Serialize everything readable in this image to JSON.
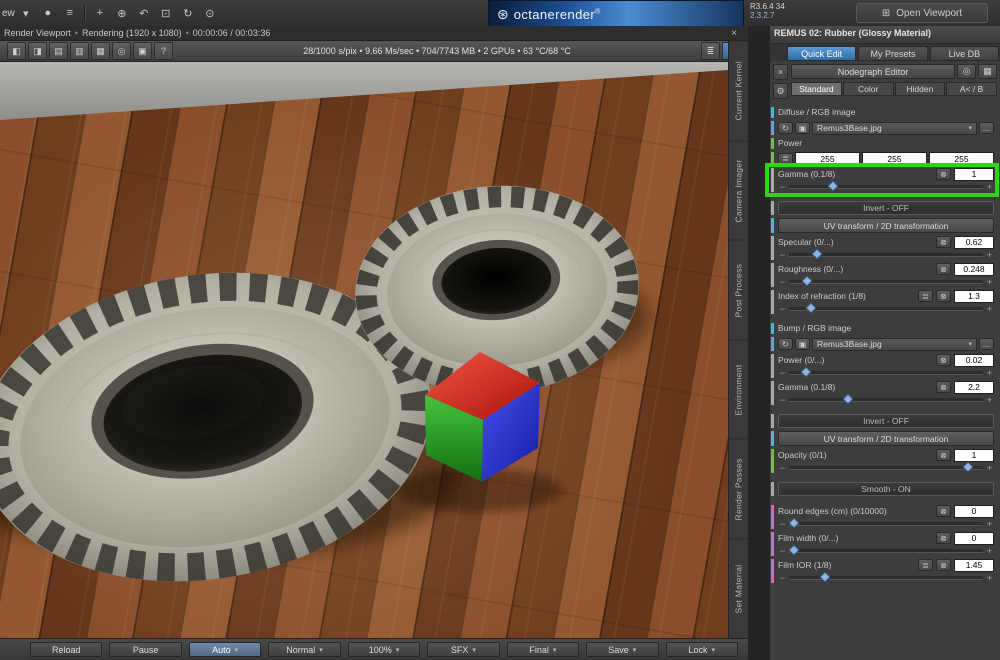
{
  "top_bar": {
    "view_label": "ew",
    "icons": [
      "▾",
      "●",
      "≡",
      "+",
      "⊕",
      "↶",
      "⊡",
      "↻",
      "⊙"
    ],
    "octane": {
      "logo": "⊛",
      "title": "octanerender",
      "reg": "®"
    },
    "version_line1": "R3.6.4 34",
    "version_line2": "2.3.2.7",
    "open_viewport": {
      "icon": "⊞",
      "label": "Open Viewport"
    }
  },
  "viewport_header": {
    "title": "Render Viewport",
    "sep": "•",
    "status": "Rendering (1920 x 1080)",
    "time": "00:00:06 / 00:03:36",
    "close": "×"
  },
  "viewport_toolbar": {
    "left_icons": [
      "◧",
      "◨",
      "▤",
      "▥",
      "▦",
      "◎",
      "▣",
      "?"
    ],
    "stats": "28/1000 s/pix • 9.66 Ms/sec • 704/7743 MB • 2 GPUs • 63 °C/68 °C",
    "right_icons": [
      "≣",
      "◪"
    ]
  },
  "side_tabs": [
    "Current Kernel",
    "Camera Imager",
    "Post Process",
    "Environment",
    "Render Passes",
    "Set Material"
  ],
  "icons": {
    "list": "≣",
    "circle": "⊗",
    "minus": "−",
    "plus": "+",
    "arrow_down": "▾",
    "refresh": "↻",
    "export": "▣",
    "more": "…"
  },
  "material_panel": {
    "title": "REMUS 02: Rubber (Glossy Material)",
    "tabs": [
      {
        "label": "Quick Edit",
        "active": true
      },
      {
        "label": "My Presets",
        "active": false
      },
      {
        "label": "Live DB",
        "active": false
      }
    ],
    "mini": {
      "close": "×",
      "gear": "⚙"
    },
    "nodegraph_label": "Nodegraph Editor",
    "nodegraph_icons": [
      "◎",
      "▦"
    ],
    "subtabs": [
      {
        "label": "Standard",
        "active": true
      },
      {
        "label": "Color",
        "active": false
      },
      {
        "label": "Hidden",
        "active": false
      },
      {
        "label": "A< / B",
        "active": false
      }
    ],
    "params": [
      {
        "kind": "tex-header",
        "label": "Diffuse / RGB image",
        "strip": "#4ab6cf"
      },
      {
        "kind": "tex-row",
        "file": "Remus3Base.jpg",
        "strip": "#4ab6cf"
      },
      {
        "kind": "label",
        "label": "Power",
        "strip": "#79b94e"
      },
      {
        "kind": "rgb",
        "r": "255",
        "g": "255",
        "b": "255",
        "strip": "#79b94e"
      },
      {
        "kind": "slider",
        "label": "Gamma (0.1/8)",
        "value": "1",
        "pos": 22,
        "strip": "#a9a9a9",
        "highlight": true
      },
      {
        "kind": "toggle",
        "label": "Invert - OFF",
        "strip": "#a9a9a9"
      },
      {
        "kind": "section",
        "label": "UV transform / 2D transformation",
        "strip": "#4ab6cf"
      },
      {
        "kind": "slider",
        "label": "Specular (0/...)",
        "value": "0.62",
        "pos": 14,
        "strip": "#a9a9a9"
      },
      {
        "kind": "slider",
        "label": "Roughness (0/...)",
        "value": "0.248",
        "pos": 9,
        "strip": "#a9a9a9"
      },
      {
        "kind": "slider",
        "label": "Index of refraction (1/8)",
        "value": "1.3",
        "pos": 11,
        "strip": "#a9a9a9",
        "has_list": true
      },
      {
        "kind": "tex-header",
        "label": "Bump / RGB image",
        "strip": "#4ab6cf"
      },
      {
        "kind": "tex-row",
        "file": "Remus3Base.jpg",
        "strip": "#4ab6cf"
      },
      {
        "kind": "slider",
        "label": "Power (0/...)",
        "value": "0.02",
        "pos": 8,
        "strip": "#a9a9a9"
      },
      {
        "kind": "slider",
        "label": "Gamma (0.1/8)",
        "value": "2.2",
        "pos": 30,
        "strip": "#a9a9a9"
      },
      {
        "kind": "toggle",
        "label": "Invert - OFF",
        "strip": "#a9a9a9"
      },
      {
        "kind": "section",
        "label": "UV transform / 2D transformation",
        "strip": "#4ab6cf"
      },
      {
        "kind": "slider",
        "label": "Opacity (0/1)",
        "value": "1",
        "pos": 92,
        "strip": "#79b94e"
      },
      {
        "kind": "toggle",
        "label": "Smooth - ON",
        "strip": "#a9a9a9"
      },
      {
        "kind": "slider",
        "label": "Round edges (cm) (0/10000)",
        "value": "0",
        "pos": 2,
        "strip": "#d66ab8"
      },
      {
        "kind": "slider",
        "label": "Film width (0/...)",
        "value": "0",
        "pos": 2,
        "strip": "#d66ab8"
      },
      {
        "kind": "slider",
        "label": "Film IOR (1/8)",
        "value": "1.45",
        "pos": 18,
        "strip": "#d66ab8",
        "has_list": true
      }
    ]
  },
  "bottom_toolbar": {
    "buttons": [
      {
        "label": "Reload",
        "arrow": false
      },
      {
        "label": "Pause",
        "arrow": false
      },
      {
        "label": "Auto",
        "arrow": true,
        "active": true
      },
      {
        "label": "Normal",
        "arrow": true
      },
      {
        "label": "100%",
        "arrow": true
      },
      {
        "label": "SFX",
        "arrow": true
      },
      {
        "label": "Final",
        "arrow": true
      },
      {
        "label": "Save",
        "arrow": true
      },
      {
        "label": "Lock",
        "arrow": true
      }
    ]
  },
  "colors": {
    "highlight_green": "#2fd418",
    "accent_blue": "#2e6da4"
  }
}
